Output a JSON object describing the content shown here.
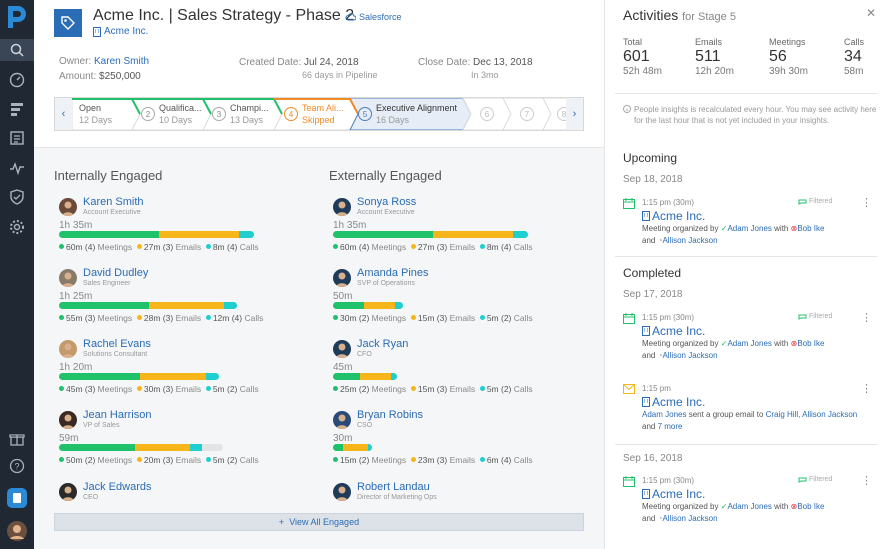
{
  "deal": {
    "title": "Acme Inc. | Sales Strategy - Phase 2",
    "crm_link": "Salesforce",
    "account": "Acme Inc.",
    "owner_label": "Owner:",
    "owner": "Karen Smith",
    "amount_label": "Amount:",
    "amount": "$250,000",
    "created_label": "Created Date:",
    "created": "Jul 24, 2018",
    "created_sub": "66 days in Pipeline",
    "close_label": "Close Date:",
    "close": "Dec 13, 2018",
    "close_sub": "In 3mo"
  },
  "stages": [
    {
      "num": "",
      "name": "Open",
      "detail": "12 Days",
      "state": "done"
    },
    {
      "num": "2",
      "name": "Qualifica...",
      "detail": "10 Days",
      "state": "done"
    },
    {
      "num": "3",
      "name": "Champi...",
      "detail": "13 Days",
      "state": "done"
    },
    {
      "num": "4",
      "name": "Team Ali...",
      "detail": "Skipped",
      "state": "skipped"
    },
    {
      "num": "5",
      "name": "Executive Alignment",
      "detail": "16 Days",
      "state": "current"
    },
    {
      "num": "6",
      "name": "",
      "detail": "",
      "state": "future"
    },
    {
      "num": "7",
      "name": "",
      "detail": "",
      "state": "future"
    },
    {
      "num": "8",
      "name": "",
      "detail": "",
      "state": "future"
    }
  ],
  "internal": {
    "title": "Internally Engaged",
    "people": [
      {
        "name": "Karen Smith",
        "title": "Account Executive",
        "duration": "1h 35m",
        "meetings": "60m (4)",
        "emails": "27m (3)",
        "calls": "8m (4)",
        "bar": [
          0.53,
          0.42,
          0.08
        ],
        "total": 0.95,
        "avatar": "#6b4a3a"
      },
      {
        "name": "David Dudley",
        "title": "Sales Engineer",
        "duration": "1h 25m",
        "meetings": "55m (3)",
        "emails": "28m (3)",
        "calls": "12m (4)",
        "bar": [
          0.49,
          0.41,
          0.07
        ],
        "total": 0.87,
        "avatar": "#8a7a6a"
      },
      {
        "name": "Rachel Evans",
        "title": "Solutions Consultant",
        "duration": "1h 20m",
        "meetings": "45m (3)",
        "emails": "30m (3)",
        "calls": "5m (2)",
        "bar": [
          0.43,
          0.35,
          0.07
        ],
        "total": 0.78,
        "avatar": "#c49a6c"
      },
      {
        "name": "Jean Harrison",
        "title": "VP of Sales",
        "duration": "59m",
        "meetings": "50m (2)",
        "emails": "20m (3)",
        "calls": "5m (2)",
        "bar": [
          0.37,
          0.27,
          0.06
        ],
        "total": 0.8,
        "avatar": "#3a2a22"
      },
      {
        "name": "Jack Edwards",
        "title": "CEO",
        "duration": "",
        "meetings": "",
        "emails": "",
        "calls": "",
        "bar": [
          0,
          0,
          0
        ],
        "total": 0,
        "avatar": "#2a2a2a"
      }
    ]
  },
  "external": {
    "title": "Externally Engaged",
    "people": [
      {
        "name": "Sonya Ross",
        "title": "Account Executive",
        "duration": "1h 35m",
        "meetings": "60m (4)",
        "emails": "27m (3)",
        "calls": "8m (4)",
        "bar": [
          0.53,
          0.42,
          0.08
        ],
        "total": 0.95,
        "avatar": "#1f3b5a"
      },
      {
        "name": "Amanda Pines",
        "title": "SVP of Operations",
        "duration": "50m",
        "meetings": "30m (2)",
        "emails": "15m (3)",
        "calls": "5m (2)",
        "bar": [
          0.15,
          0.15,
          0.04
        ],
        "total": 0.34,
        "avatar": "#1f3b5a"
      },
      {
        "name": "Jack Ryan",
        "title": "CFO",
        "duration": "45m",
        "meetings": "25m (2)",
        "emails": "15m (3)",
        "calls": "5m (2)",
        "bar": [
          0.13,
          0.15,
          0.03
        ],
        "total": 0.31,
        "avatar": "#1f3b5a"
      },
      {
        "name": "Bryan Robins",
        "title": "CSO",
        "duration": "30m",
        "meetings": "15m (2)",
        "emails": "23m (3)",
        "calls": "6m (4)",
        "bar": [
          0.05,
          0.12,
          0.02
        ],
        "total": 0.19,
        "avatar": "#2a4b7a"
      },
      {
        "name": "Robert Landau",
        "title": "Director of Marketing Ops",
        "duration": "",
        "meetings": "",
        "emails": "",
        "calls": "",
        "bar": [
          0,
          0,
          0
        ],
        "total": 0,
        "avatar": "#1f3b5a"
      }
    ]
  },
  "legend": {
    "meetings": "Meetings",
    "emails": "Emails",
    "calls": "Calls"
  },
  "view_all": "View All Engaged",
  "panel": {
    "title": "Activities",
    "subtitle": "for Stage 5",
    "stats": [
      {
        "label": "Total",
        "value": "601",
        "sub": "52h 48m"
      },
      {
        "label": "Emails",
        "value": "511",
        "sub": "12h 20m"
      },
      {
        "label": "Meetings",
        "value": "56",
        "sub": "39h 30m"
      },
      {
        "label": "Calls",
        "value": "34",
        "sub": "58m"
      }
    ],
    "info": "People insights is recalculated every hour. You may see activity here for the last hour that is not yet included in your insights.",
    "upcoming": "Upcoming",
    "completed": "Completed",
    "dates": [
      "Sep 18, 2018",
      "Sep 17, 2018",
      "Sep 16, 2018"
    ],
    "filtered": "Filtered",
    "activities": [
      {
        "time": "1:15 pm (30m)",
        "account": "Acme Inc.",
        "organizer_prefix": "Meeting organized by",
        "organizer": "Adam Jones",
        "with": "with",
        "attendee": "Bob Ike",
        "and": "and",
        "extra": "Allison Jackson"
      },
      {
        "time": "1:15 pm (30m)",
        "account": "Acme Inc.",
        "organizer_prefix": "Meeting organized by",
        "organizer": "Adam Jones",
        "with": "with",
        "attendee": "Bob Ike",
        "and": "and",
        "extra": "Allison Jackson"
      },
      {
        "time": "1:15 pm",
        "account": "Acme Inc.",
        "sender": "Adam Jones",
        "sent_text": "sent a group email to",
        "recipients": "Craig Hill, Allison Jackson",
        "and": "and",
        "more": "7 more"
      },
      {
        "time": "1:15 pm (30m)",
        "account": "Acme Inc.",
        "organizer_prefix": "Meeting organized by",
        "organizer": "Adam Jones",
        "with": "with",
        "attendee": "Bob Ike",
        "and": "and",
        "extra": "Allison Jackson"
      }
    ]
  },
  "colors": {
    "meetings": "#1fc16b",
    "emails": "#f5b51b",
    "calls": "#1fcfd0",
    "brand": "#2a6cb6",
    "sidebar": "#1f2833"
  }
}
